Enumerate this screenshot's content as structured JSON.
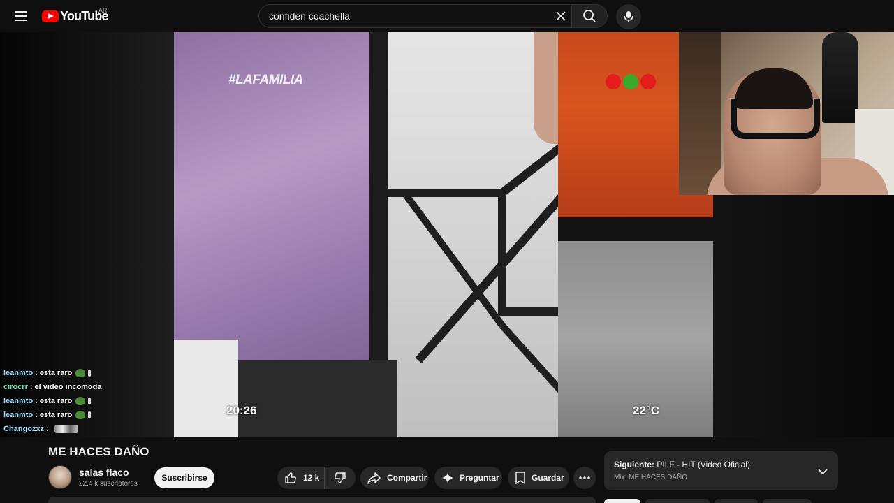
{
  "header": {
    "logo_text": "YouTube",
    "region": "AR",
    "search_value": "confiden coachella"
  },
  "video": {
    "overlay_hashtag": "#LAFAMILIA",
    "overlay_time": "20:26",
    "overlay_temp": "22°C"
  },
  "chat": [
    {
      "user": "leanmto",
      "message": "esta raro",
      "color": "#9edcff"
    },
    {
      "user": "cirocrr",
      "message": "el video incomoda",
      "color": "#7ae0b0"
    },
    {
      "user": "leanmto",
      "message": "esta raro",
      "color": "#9edcff"
    },
    {
      "user": "leanmto",
      "message": "esta raro",
      "color": "#9edcff"
    },
    {
      "user": "Changozxz",
      "message": "",
      "color": "#9edcff"
    }
  ],
  "details": {
    "title": "ME HACES DAÑO",
    "channel": "salas flaco",
    "subscribers": "22.4 k suscriptores",
    "subscribe_label": "Suscribirse",
    "likes": "12 k",
    "share_label": "Compartir",
    "ask_label": "Preguntar",
    "save_label": "Guardar"
  },
  "next": {
    "prefix": "Siguiente:",
    "title": "PILF - HIT (Video Oficial)",
    "mix": "Mix: ME HACES DAÑO"
  },
  "colors": {
    "background": "#0f0f0f",
    "brand_red": "#ff0000",
    "pill": "#272727"
  }
}
